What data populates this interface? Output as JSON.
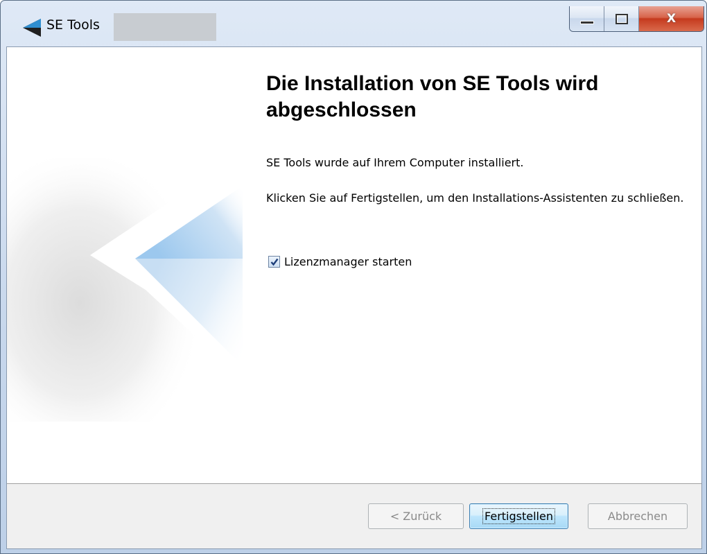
{
  "window": {
    "title": "SE Tools",
    "controls": {
      "minimize": "minimize",
      "maximize": "maximize",
      "close_glyph": "X"
    }
  },
  "content": {
    "heading": "Die Installation von SE Tools wird abgeschlossen",
    "paragraph1": "SE Tools wurde auf Ihrem Computer installiert.",
    "paragraph2": "Klicken Sie auf Fertigstellen, um den Installations-Assistenten zu schließen.",
    "checkbox": {
      "label": "Lizenzmanager starten",
      "checked": true
    }
  },
  "buttons": {
    "back": "< Zurück",
    "finish": "Fertigstellen",
    "cancel": "Abbrechen"
  },
  "icons": {
    "app": "se-tools-logo-icon",
    "check": "checkmark-icon"
  },
  "colors": {
    "accent": "#3c7fb1",
    "decoration_blue": "#a9d0ef"
  }
}
